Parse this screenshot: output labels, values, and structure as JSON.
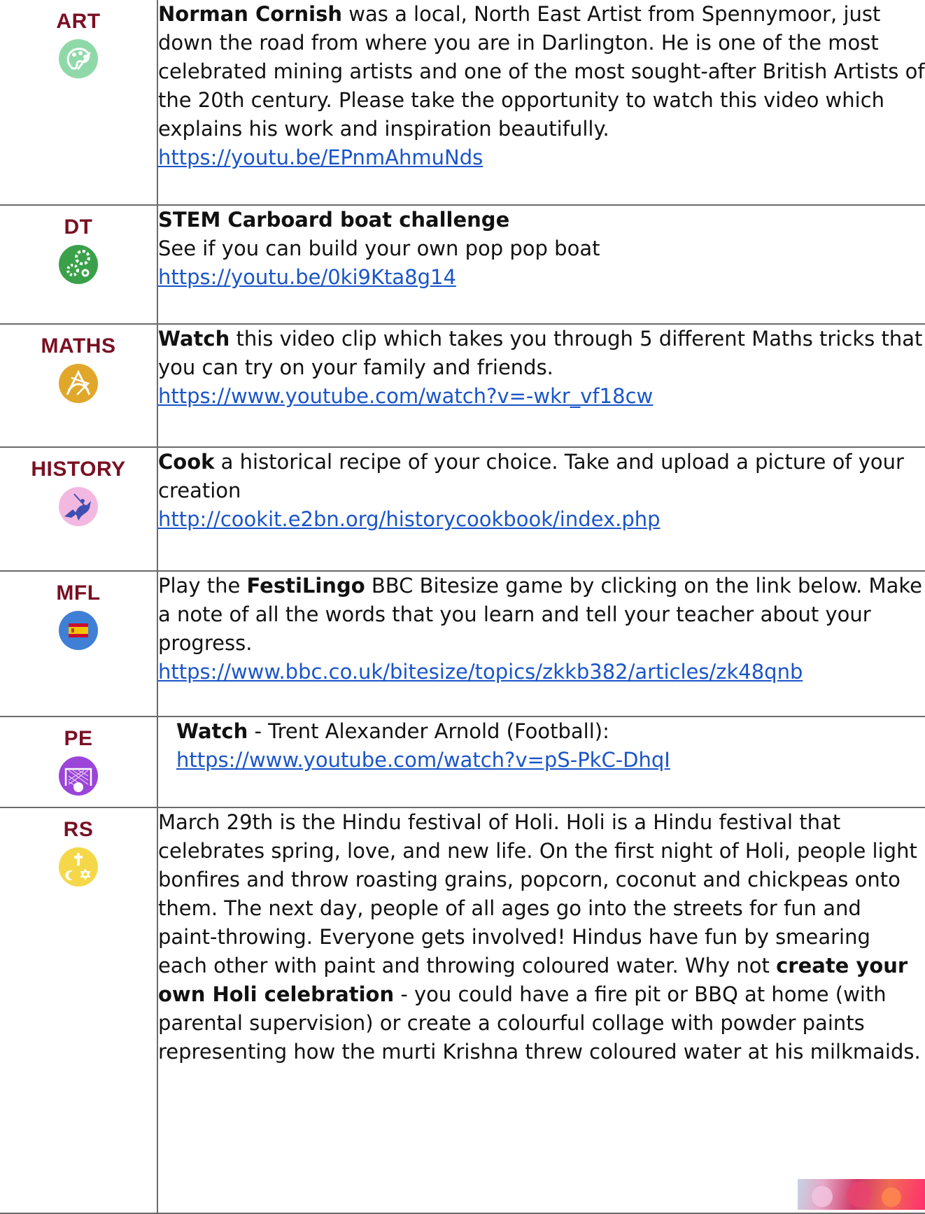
{
  "rows": [
    {
      "subject": "ART",
      "icon": "palette-icon",
      "icon_color": "#8fd9a8",
      "lead_bold": "Norman Cornish",
      "text": " was a local, North East Artist from Spennymoor, just down the road from where you are in Darlington. He is one of the most celebrated mining artists and one of the most sought-after British Artists of the 20th century. Please take the opportunity to watch this video which explains his work and inspiration beautifully.",
      "link": "https://youtu.be/EPnmAhmuNds"
    },
    {
      "subject": "DT",
      "icon": "gears-icon",
      "icon_color": "#3aa14a",
      "lead_bold": "STEM Carboard boat challenge",
      "text": "See if you can build your own pop pop boat",
      "link": "https://youtu.be/0ki9Kta8g14"
    },
    {
      "subject": "MATHS",
      "icon": "geometry-tools-icon",
      "icon_color": "#e0a72a",
      "lead_bold": "Watch",
      "text": " this video clip which takes you through 5 different Maths tricks that you can try on your family and friends.",
      "link": "https://www.youtube.com/watch?v=-wkr_vf18cw"
    },
    {
      "subject": "HISTORY",
      "icon": "knight-horse-icon",
      "icon_color": "#f2b8e0",
      "lead_bold": "Cook",
      "text": " a historical recipe of your choice. Take and upload a picture of your creation",
      "link": "http://cookit.e2bn.org/historycookbook/index.php"
    },
    {
      "subject": "MFL",
      "icon": "spain-flag-icon",
      "icon_color": "#3f7fd6",
      "pre_text": "Play the ",
      "lead_bold": "FestiLingo",
      "text": " BBC Bitesize game by clicking on the link below. Make a note of all the words that you learn and tell your teacher about your progress.",
      "link": "https://www.bbc.co.uk/bitesize/topics/zkkb382/articles/zk48qnb"
    },
    {
      "subject": "PE",
      "icon": "football-goal-icon",
      "icon_color": "#9b45d9",
      "lead_bold": "Watch",
      "text": " - Trent Alexander Arnold (Football):",
      "link": "https://www.youtube.com/watch?v=pS-PkC-DhqI"
    },
    {
      "subject": "RS",
      "icon": "religious-symbols-icon",
      "icon_color": "#f5d84a",
      "text": "March 29th is the Hindu festival of Holi. Holi is a Hindu festival that celebrates spring, love, and new life. On the first night of Holi, people light bonfires and throw roasting grains, popcorn, coconut and chickpeas onto them. The next day, people of all ages go into the streets for fun and paint-throwing. Everyone gets involved! Hindus have fun by smearing each other with paint and throwing coloured water. Why not ",
      "mid_bold": "create your own Holi celebration",
      "text_after": " - you could have a fire pit or BBQ at home (with parental supervision) or create a colourful collage with powder paints representing how the murti Krishna threw coloured water at his milkmaids."
    }
  ]
}
